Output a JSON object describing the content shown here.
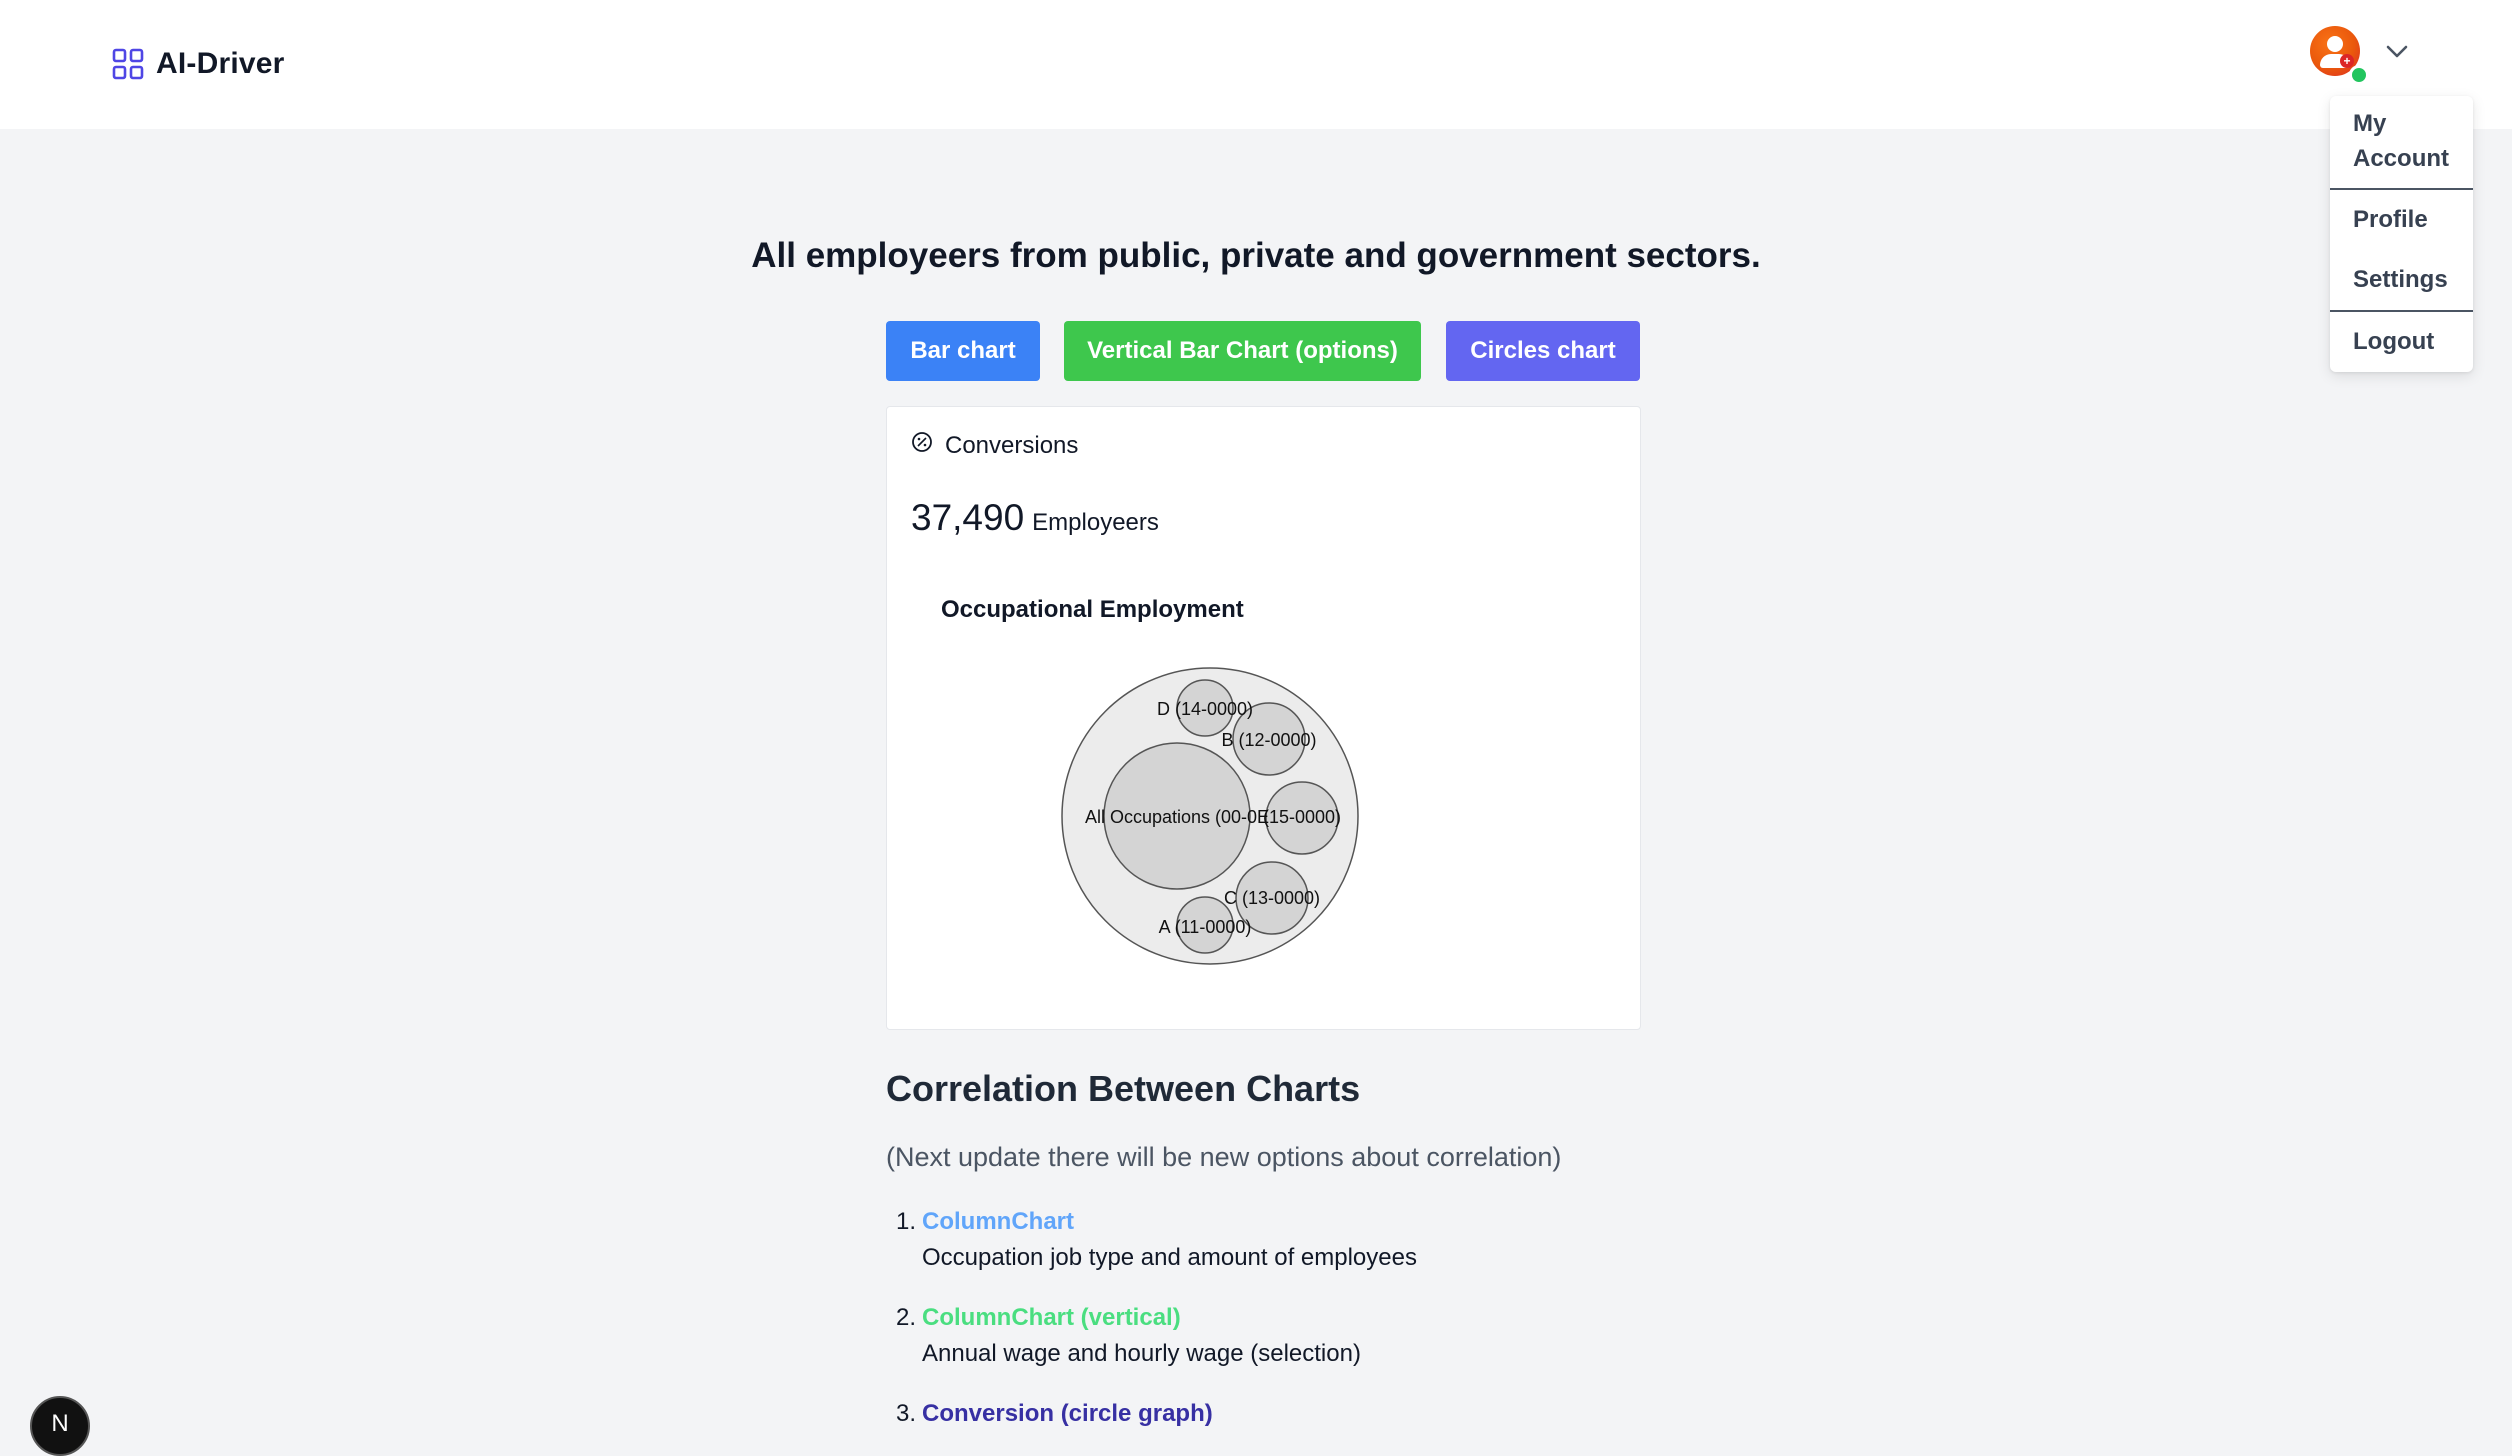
{
  "app": {
    "name": "AI-Driver"
  },
  "user_menu": {
    "items": [
      {
        "label": "My\nAccount"
      },
      {
        "label": "Profile"
      },
      {
        "label": "Settings"
      },
      {
        "label": "Logout"
      }
    ],
    "my_account_line1": "My",
    "my_account_line2": "Account",
    "profile": "Profile",
    "settings": "Settings",
    "logout": "Logout"
  },
  "page": {
    "title": "All employeers from public, private and government sectors.",
    "buttons": {
      "bar": "Bar chart",
      "vertical_bar": "Vertical Bar Chart (options)",
      "circles": "Circles chart"
    }
  },
  "card": {
    "label": "Conversions",
    "stat_value": "37,490",
    "stat_unit": "Employeers"
  },
  "chart_data": {
    "type": "circle-packing",
    "title": "Occupational Employment",
    "nodes": [
      {
        "label": "All Occupations (00-0000)",
        "shown_label": "All Occupations (00-0E",
        "relative_size": 1.0
      },
      {
        "label": "D (14-0000)",
        "relative_size": 0.1
      },
      {
        "label": "B (12-0000)",
        "relative_size": 0.21
      },
      {
        "label": "E (15-0000)",
        "shown_label": "(15-0000)",
        "relative_size": 0.21
      },
      {
        "label": "C (13-0000)",
        "relative_size": 0.21
      },
      {
        "label": "A (11-0000)",
        "relative_size": 0.1
      }
    ],
    "colors": {
      "outer": "#ececec",
      "inner": "#d4d4d4",
      "stroke": "#555555"
    }
  },
  "correlation": {
    "title": "Correlation Between Charts",
    "subtitle": "(Next update there will be new options about correlation)",
    "items": [
      {
        "num": "1.",
        "link": "ColumnChart",
        "desc": "Occupation job type and amount of employees",
        "color": "#60a5fa"
      },
      {
        "num": "2.",
        "link": "ColumnChart (vertical)",
        "desc": "Annual wage and hourly wage (selection)",
        "color": "#4ade80"
      },
      {
        "num": "3.",
        "link": "Conversion (circle graph)",
        "desc": "",
        "color": "#3730a3"
      }
    ]
  },
  "corner_badge": {
    "label": "N"
  }
}
